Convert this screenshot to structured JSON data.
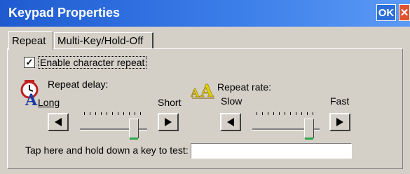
{
  "window": {
    "title": "Keypad Properties",
    "ok_label": "OK",
    "close_label": "✕"
  },
  "tabs": [
    {
      "label": "Repeat",
      "active": true
    },
    {
      "label": "Multi-Key/Hold-Off",
      "active": false
    }
  ],
  "repeat": {
    "enable_label": "Enable character repeat",
    "enable_checked": true
  },
  "delay": {
    "label": "Repeat delay:",
    "left_label": "Long",
    "right_label": "Short",
    "level": 0.85,
    "icon": "stopwatch-icon"
  },
  "rate": {
    "label": "Repeat rate:",
    "left_label": "Slow",
    "right_label": "Fast",
    "level": 0.9,
    "icon": "text-size-icon"
  },
  "test": {
    "label": "Tap here and hold down a key to test:",
    "value": ""
  }
}
